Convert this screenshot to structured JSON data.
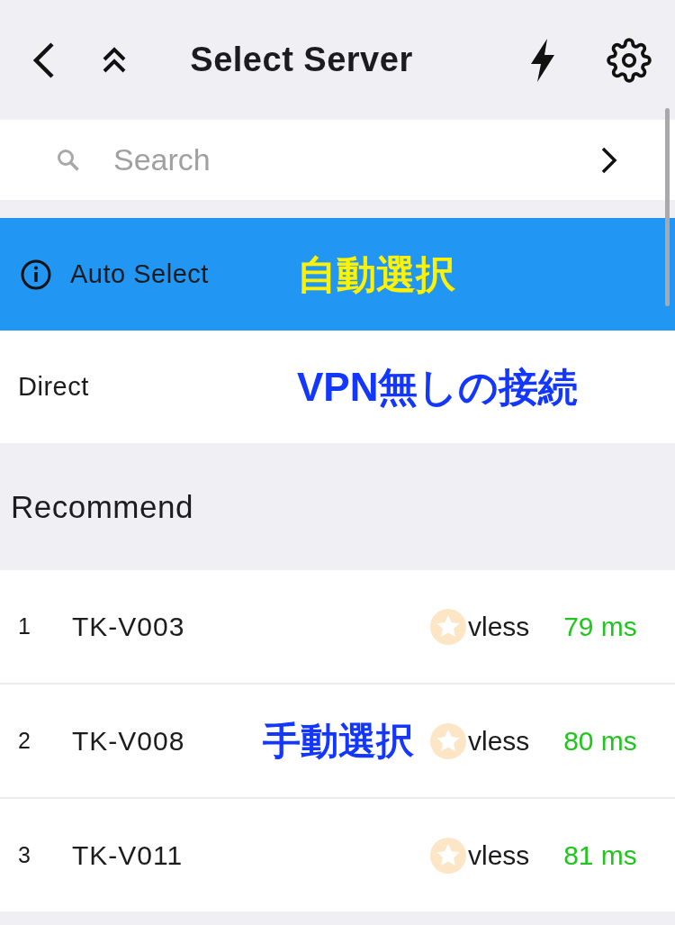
{
  "header": {
    "title": "Select Server"
  },
  "search": {
    "placeholder": "Search"
  },
  "modes": [
    {
      "kind": "auto",
      "label": "Auto Select",
      "selected": true,
      "note": {
        "text": "自動選択",
        "color": "#fff200"
      }
    },
    {
      "kind": "direct",
      "label": "Direct",
      "selected": false,
      "note": {
        "text": "VPN無しの接続",
        "color": "#1437ff"
      }
    }
  ],
  "recommend": {
    "title": "Recommend",
    "note": {
      "text": "手動選択",
      "color": "#1437ff"
    },
    "servers": [
      {
        "rank": "1",
        "name": "TK-V003",
        "protocol": "vless",
        "latency": "79 ms"
      },
      {
        "rank": "2",
        "name": "TK-V008",
        "protocol": "vless",
        "latency": "80 ms"
      },
      {
        "rank": "3",
        "name": "TK-V011",
        "protocol": "vless",
        "latency": "81 ms"
      }
    ]
  }
}
